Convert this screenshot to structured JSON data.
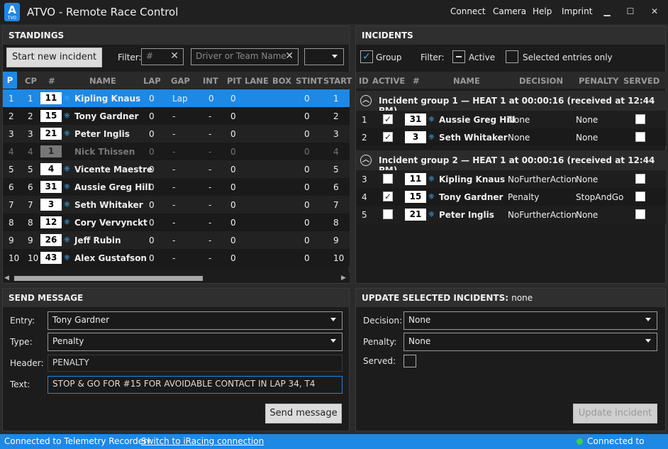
{
  "app": {
    "logo_letter": "A",
    "logo_sub": "TVO",
    "title": "ATVO - Remote Race Control"
  },
  "menu": {
    "connect": "Connect",
    "camera": "Camera",
    "help": "Help",
    "imprint": "Imprint"
  },
  "window": {
    "minimize": "▁",
    "maximize": "☐",
    "close": "✕"
  },
  "standings": {
    "title": "STANDINGS",
    "start_incident": "Start new incident",
    "filter_label": "Filter:",
    "filter_number_ph": "#",
    "filter_name_ph": "Driver or Team Name",
    "columns": {
      "p": "P",
      "cp": "CP",
      "num": "#",
      "name": "NAME",
      "lap": "LAP",
      "gap": "GAP",
      "int": "INT",
      "pit": "PIT",
      "lane": "LANE",
      "box": "BOX",
      "stint": "STINT",
      "start": "START"
    },
    "rows": [
      {
        "p": "1",
        "cp": "1",
        "num": "11",
        "name": "Kipling Knaus",
        "lap": "0",
        "gap": "Lap",
        "int": "0",
        "pit": "0",
        "stint": "0",
        "start": "1"
      },
      {
        "p": "2",
        "cp": "2",
        "num": "15",
        "name": "Tony Gardner",
        "lap": "0",
        "gap": "-",
        "int": "-",
        "pit": "0",
        "stint": "0",
        "start": "2"
      },
      {
        "p": "3",
        "cp": "3",
        "num": "21",
        "name": "Peter Inglis",
        "lap": "0",
        "gap": "-",
        "int": "-",
        "pit": "0",
        "stint": "0",
        "start": "3"
      },
      {
        "p": "4",
        "cp": "4",
        "num": "1",
        "name": "Nick Thissen",
        "lap": "0",
        "gap": "-",
        "int": "-",
        "pit": "0",
        "stint": "0",
        "start": "4"
      },
      {
        "p": "5",
        "cp": "5",
        "num": "4",
        "name": "Vicente Maestre",
        "lap": "0",
        "gap": "-",
        "int": "-",
        "pit": "0",
        "stint": "0",
        "start": "5"
      },
      {
        "p": "6",
        "cp": "6",
        "num": "31",
        "name": "Aussie Greg Hill",
        "lap": "0",
        "gap": "-",
        "int": "-",
        "pit": "0",
        "stint": "0",
        "start": "6"
      },
      {
        "p": "7",
        "cp": "7",
        "num": "3",
        "name": "Seth Whitaker",
        "lap": "0",
        "gap": "-",
        "int": "-",
        "pit": "0",
        "stint": "0",
        "start": "7"
      },
      {
        "p": "8",
        "cp": "8",
        "num": "12",
        "name": "Cory Vervynckt",
        "lap": "0",
        "gap": "-",
        "int": "-",
        "pit": "0",
        "stint": "0",
        "start": "8"
      },
      {
        "p": "9",
        "cp": "9",
        "num": "26",
        "name": "Jeff Rubin",
        "lap": "0",
        "gap": "-",
        "int": "-",
        "pit": "0",
        "stint": "0",
        "start": "9"
      },
      {
        "p": "10",
        "cp": "10",
        "num": "43",
        "name": "Alex Gustafson",
        "lap": "0",
        "gap": "-",
        "int": "-",
        "pit": "0",
        "stint": "0",
        "start": "10"
      }
    ]
  },
  "incidents": {
    "title": "INCIDENTS",
    "group_label": "Group",
    "filter_label": "Filter:",
    "active_label": "Active",
    "selected_label": "Selected entries only",
    "columns": {
      "id": "ID",
      "active": "ACTIVE",
      "num": "#",
      "name": "NAME",
      "decision": "DECISION",
      "penalty": "PENALTY",
      "served": "SERVED"
    },
    "groups": [
      {
        "title": "Incident group 1 — HEAT 1 at 00:00:16 (received at 12:44 PM)",
        "rows": [
          {
            "id": "1",
            "num": "31",
            "name": "Aussie Greg Hill",
            "decision": "None",
            "penalty": "None"
          },
          {
            "id": "2",
            "num": "3",
            "name": "Seth Whitaker",
            "decision": "None",
            "penalty": "None"
          }
        ]
      },
      {
        "title": "Incident group 2 — HEAT 1 at 00:00:16 (received at 12:44 PM)",
        "rows": [
          {
            "id": "3",
            "num": "11",
            "name": "Kipling Knaus",
            "decision": "NoFurtherAction",
            "penalty": "None"
          },
          {
            "id": "4",
            "num": "15",
            "name": "Tony Gardner",
            "decision": "Penalty",
            "penalty": "StopAndGo"
          },
          {
            "id": "5",
            "num": "21",
            "name": "Peter Inglis",
            "decision": "NoFurtherAction",
            "penalty": "None"
          }
        ]
      }
    ]
  },
  "send_message": {
    "title": "SEND MESSAGE",
    "entry_label": "Entry:",
    "entry_value": "Tony Gardner",
    "type_label": "Type:",
    "type_value": "Penalty",
    "header_label": "Header:",
    "header_value": "PENALTY",
    "text_label": "Text:",
    "text_value": "STOP & GO FOR #15 FOR AVOIDABLE CONTACT IN LAP 34, T4",
    "send_button": "Send message"
  },
  "update": {
    "title": "UPDATE SELECTED INCIDENTS:",
    "title_value": "none",
    "decision_label": "Decision:",
    "decision_value": "None",
    "penalty_label": "Penalty:",
    "penalty_value": "None",
    "served_label": "Served:",
    "update_button": "Update incident"
  },
  "status": {
    "left": "Connected to Telemetry Recorder!",
    "link": "Switch to iRacing connection",
    "right": "Connected to ATVO!"
  },
  "colors": {
    "accent": "#1e88e5",
    "selected_row": "#1e88e5",
    "status_ok": "#3ccf4e"
  }
}
